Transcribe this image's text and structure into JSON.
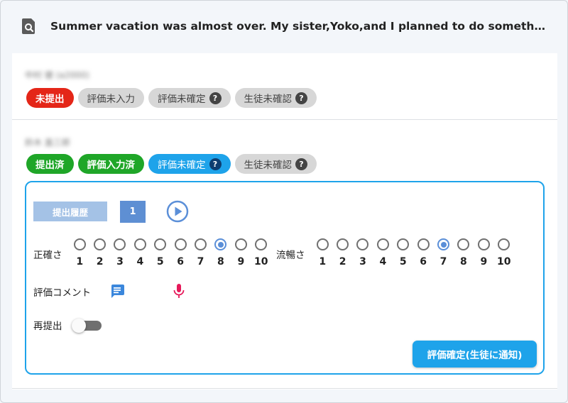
{
  "header": {
    "search_icon": "search-icon",
    "title": "Summer vacation was almost over. My sister,Yoko,and I planned to do something inter..."
  },
  "students": [
    {
      "name": "中村 健 (a2000)",
      "badges": [
        {
          "label": "未提出",
          "style": "red",
          "help": false
        },
        {
          "label": "評価未入力",
          "style": "gray",
          "help": false
        },
        {
          "label": "評価未確定",
          "style": "gray",
          "help": true
        },
        {
          "label": "生徒未確認",
          "style": "gray",
          "help": true
        }
      ]
    },
    {
      "name": "鈴木 直三郎",
      "badges": [
        {
          "label": "提出済",
          "style": "green",
          "help": false
        },
        {
          "label": "評価入力済",
          "style": "green",
          "help": false
        },
        {
          "label": "評価未確定",
          "style": "blue",
          "help": true
        },
        {
          "label": "生徒未確認",
          "style": "gray",
          "help": true
        }
      ]
    }
  ],
  "help_glyph": "?",
  "panel": {
    "history_label": "提出履歴",
    "submission_count": "1",
    "play_icon": "play-circle-icon",
    "criteria": [
      {
        "label": "正確さ",
        "options": [
          "1",
          "2",
          "3",
          "4",
          "5",
          "6",
          "7",
          "8",
          "9",
          "10"
        ],
        "selected": 8
      },
      {
        "label": "流暢さ",
        "options": [
          "1",
          "2",
          "3",
          "4",
          "5",
          "6",
          "7",
          "8",
          "9",
          "10"
        ],
        "selected": 7
      }
    ],
    "comment_label": "評価コメント",
    "comment_icon": "chat-icon",
    "mic_icon": "mic-icon",
    "resubmit_label": "再提出",
    "resubmit_on": false,
    "confirm_label": "評価確定(生徒に通知)"
  },
  "colors": {
    "accent": "#1ea3ea",
    "red": "#e42618",
    "green": "#1fa628",
    "gray_badge": "#d7d7d7",
    "radio_selected": "#5b8fd8",
    "mic": "#e6195a"
  }
}
